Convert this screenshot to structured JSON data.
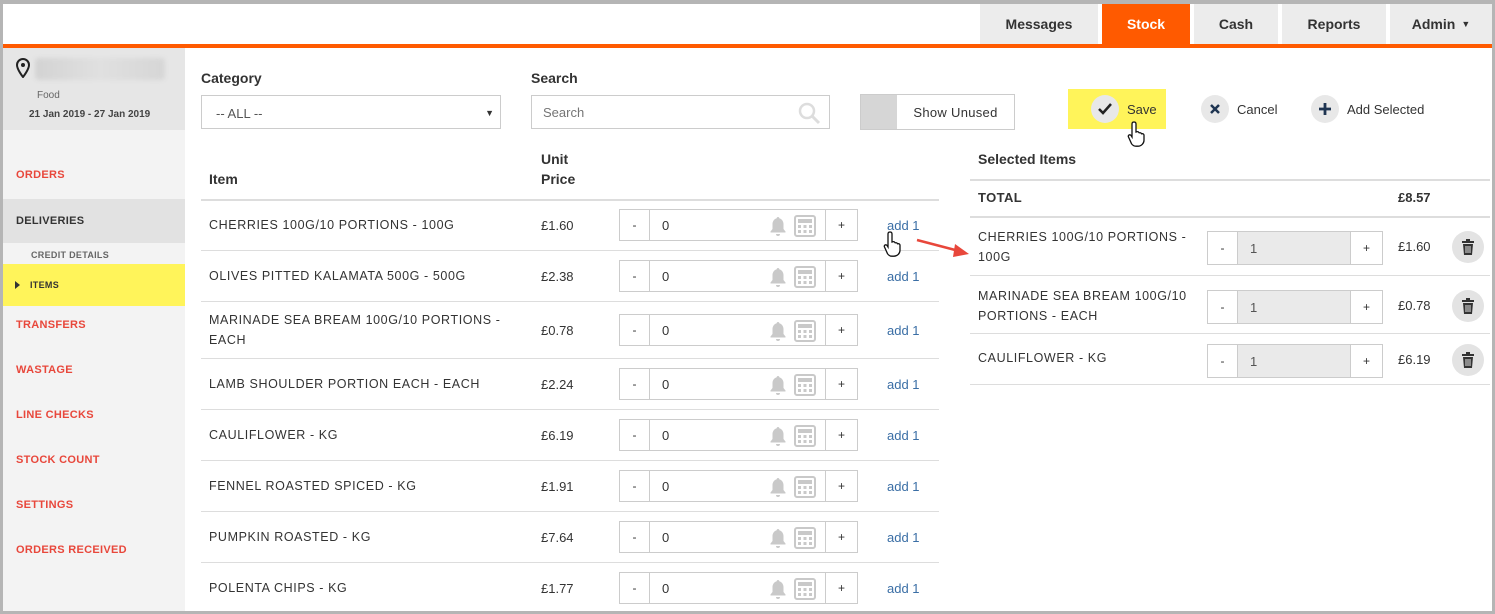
{
  "nav": {
    "tabs": [
      {
        "label": "Messages"
      },
      {
        "label": "Stock",
        "active": true
      },
      {
        "label": "Cash"
      },
      {
        "label": "Reports"
      },
      {
        "label": "Admin"
      }
    ]
  },
  "sidebar": {
    "location_type": "Food",
    "date_range": "21 Jan 2019 - 27 Jan 2019",
    "items": [
      {
        "label": "ORDERS"
      },
      {
        "label": "DELIVERIES"
      },
      {
        "label": "TRANSFERS"
      },
      {
        "label": "WASTAGE"
      },
      {
        "label": "LINE CHECKS"
      },
      {
        "label": "STOCK COUNT"
      },
      {
        "label": "SETTINGS"
      },
      {
        "label": "ORDERS RECEIVED"
      }
    ],
    "sub_heading": "CREDIT DETAILS",
    "sub_item": "ITEMS"
  },
  "filters": {
    "category_label": "Category",
    "category_value": "-- ALL --",
    "search_label": "Search",
    "search_placeholder": "Search",
    "show_unused_label": "Show Unused"
  },
  "actions": {
    "save": "Save",
    "cancel": "Cancel",
    "add_selected": "Add Selected"
  },
  "table": {
    "col_item": "Item",
    "col_unit": "Unit",
    "col_price": "Price",
    "add_label": "add 1",
    "rows": [
      {
        "name": "CHERRIES 100G/10 PORTIONS - 100G",
        "price": "£1.60",
        "qty": "0"
      },
      {
        "name": "OLIVES PITTED KALAMATA 500G - 500G",
        "price": "£2.38",
        "qty": "0"
      },
      {
        "name": "MARINADE SEA BREAM 100G/10 PORTIONS - EACH",
        "price": "£0.78",
        "qty": "0"
      },
      {
        "name": "LAMB SHOULDER PORTION EACH - EACH",
        "price": "£2.24",
        "qty": "0"
      },
      {
        "name": "CAULIFLOWER - KG",
        "price": "£6.19",
        "qty": "0"
      },
      {
        "name": "FENNEL ROASTED SPICED - KG",
        "price": "£1.91",
        "qty": "0"
      },
      {
        "name": "PUMPKIN ROASTED - KG",
        "price": "£7.64",
        "qty": "0"
      },
      {
        "name": "POLENTA CHIPS - KG",
        "price": "£1.77",
        "qty": "0"
      }
    ]
  },
  "selected": {
    "title": "Selected Items",
    "total_label": "TOTAL",
    "total_value": "£8.57",
    "rows": [
      {
        "name": "CHERRIES 100G/10 PORTIONS - 100G",
        "qty": "1",
        "price": "£1.60"
      },
      {
        "name": "MARINADE SEA BREAM 100G/10 PORTIONS - EACH",
        "qty": "1",
        "price": "£0.78"
      },
      {
        "name": "CAULIFLOWER - KG",
        "qty": "1",
        "price": "£6.19"
      }
    ]
  },
  "stepper": {
    "minus": "-",
    "plus": "+"
  },
  "colors": {
    "accent": "#ff5a00",
    "highlight": "#fff45a",
    "link": "#3a6ea5",
    "sidebar_link": "#e8473b"
  }
}
